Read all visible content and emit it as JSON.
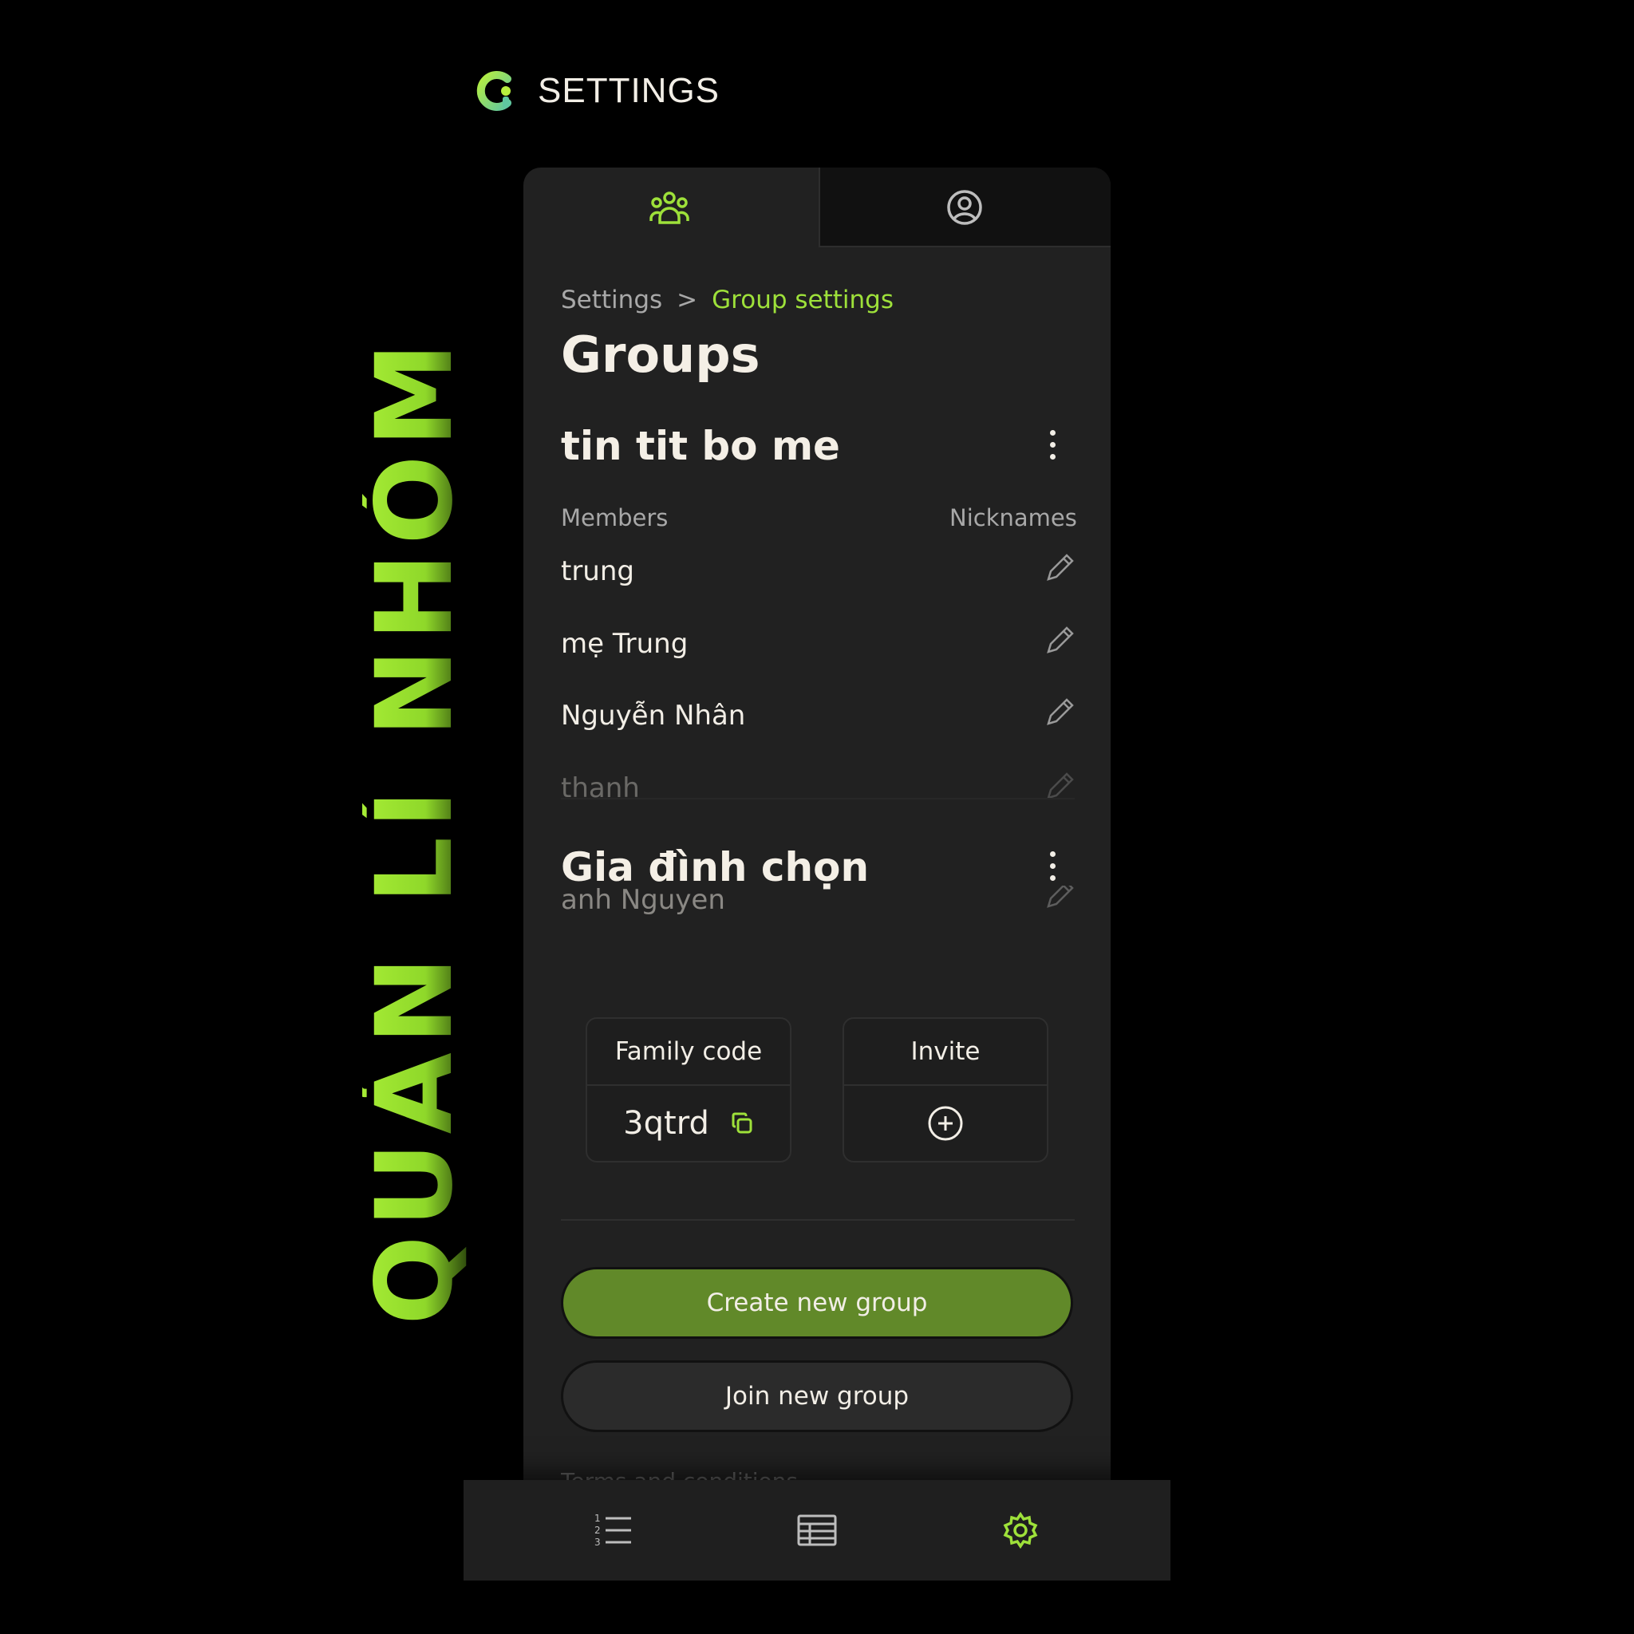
{
  "header": {
    "title": "SETTINGS",
    "logo_icon": "app-logo-icon"
  },
  "banner": {
    "text": "QUẢN LÍ NHÓM",
    "color": "#a6ec35"
  },
  "tabs": [
    {
      "name": "groups",
      "icon": "people-group-icon",
      "active": true,
      "color": "#9ee13a"
    },
    {
      "name": "profile",
      "icon": "user-circle-icon",
      "active": false,
      "color": "#bdbdbd"
    }
  ],
  "breadcrumb": {
    "parent": "Settings",
    "separator": ">",
    "current": "Group settings"
  },
  "page_title": "Groups",
  "groups": [
    {
      "name": "tin tit bo me",
      "members_label": "Members",
      "nicknames_label": "Nicknames",
      "members": [
        "trung",
        "mẹ Trung",
        "Nguyễn Nhân",
        "thanh"
      ]
    },
    {
      "name": "Gia đình chọn",
      "members": [
        "anh Nguyen"
      ]
    }
  ],
  "family_code": {
    "label": "Family code",
    "value": "3qtrd",
    "icon": "copy-icon"
  },
  "invite": {
    "label": "Invite",
    "icon": "plus-circle-icon"
  },
  "buttons": {
    "create": "Create new group",
    "join": "Join new group"
  },
  "terms": "Terms and conditions",
  "bottom_nav": [
    {
      "name": "list",
      "icon": "numbered-list-icon",
      "active": false
    },
    {
      "name": "table",
      "icon": "table-icon",
      "active": false
    },
    {
      "name": "settings",
      "icon": "gear-icon",
      "active": true
    }
  ],
  "colors": {
    "accent": "#9ee13a",
    "primary_button": "#618929",
    "panel": "#212121",
    "background": "#000000"
  }
}
